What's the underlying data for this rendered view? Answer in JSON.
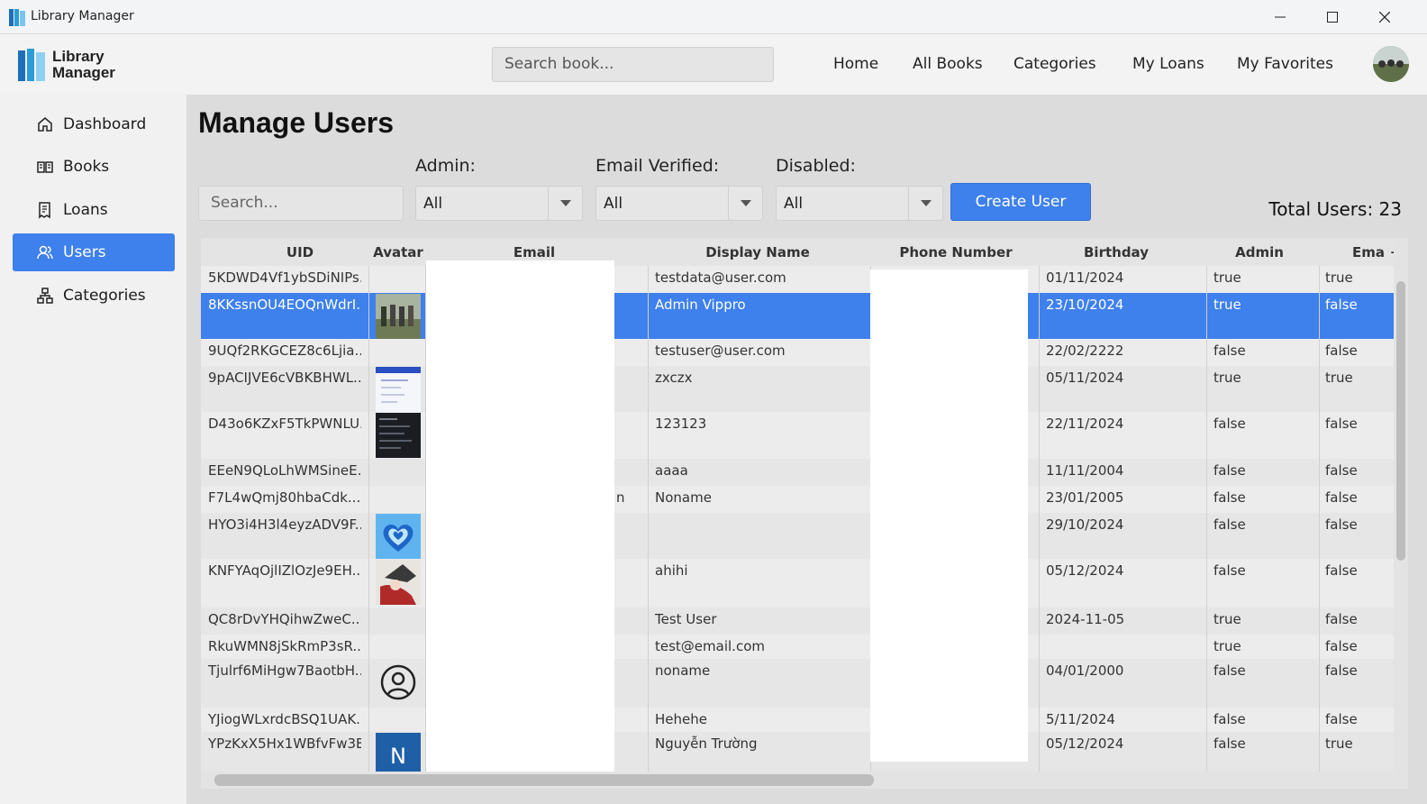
{
  "window": {
    "title": "Library Manager"
  },
  "header": {
    "logo_line1": "Library",
    "logo_line2": "Manager",
    "search_placeholder": "Search book...",
    "nav": [
      "Home",
      "All Books",
      "Categories",
      "My Loans",
      "My Favorites"
    ]
  },
  "sidebar": {
    "items": [
      {
        "label": "Dashboard",
        "icon": "home-icon"
      },
      {
        "label": "Books",
        "icon": "book-icon"
      },
      {
        "label": "Loans",
        "icon": "receipt-icon"
      },
      {
        "label": "Users",
        "icon": "users-icon",
        "active": true
      },
      {
        "label": "Categories",
        "icon": "hierarchy-icon"
      }
    ]
  },
  "main": {
    "title": "Manage Users",
    "search_placeholder": "Search...",
    "filters": [
      {
        "label": "Admin:",
        "value": "All"
      },
      {
        "label": "Email Verified:",
        "value": "All"
      },
      {
        "label": "Disabled:",
        "value": "All"
      }
    ],
    "create_button": "Create User",
    "total": "Total Users: 23"
  },
  "table": {
    "columns": [
      "UID",
      "Avatar",
      "Email",
      "Display Name",
      "Phone Number",
      "Birthday",
      "Admin",
      "Ema"
    ],
    "rows": [
      {
        "uid": "5KDWD4Vf1ybSDiNIPs...",
        "avatar": "",
        "display": "testdata@user.com",
        "birthday": "01/11/2024",
        "admin": "true",
        "email_verified": "true"
      },
      {
        "uid": "8KKssnOU4EOQnWdrI...",
        "avatar": "photo-group",
        "display": "Admin Vippro",
        "birthday": "23/10/2024",
        "admin": "true",
        "email_verified": "false",
        "selected": true
      },
      {
        "uid": "9UQf2RKGCEZ8c6Ljia...",
        "avatar": "",
        "display": "testuser@user.com",
        "birthday": "22/02/2222",
        "admin": "false",
        "email_verified": "false"
      },
      {
        "uid": "9pACIJVE6cVBKBHWL...",
        "avatar": "screenshot-light",
        "display": "zxczx",
        "birthday": "05/11/2024",
        "admin": "true",
        "email_verified": "true"
      },
      {
        "uid": "D43o6KZxF5TkPWNLU...",
        "avatar": "screenshot-dark",
        "display": "123123",
        "birthday": "22/11/2024",
        "admin": "false",
        "email_verified": "false"
      },
      {
        "uid": "EEeN9QLoLhWMSineE...",
        "avatar": "",
        "display": "aaaa",
        "birthday": "11/11/2004",
        "admin": "false",
        "email_verified": "false"
      },
      {
        "uid": "F7L4wQmj80hbaCdk...",
        "avatar": "",
        "display": "Noname",
        "birthday": "23/01/2005",
        "admin": "false",
        "email_verified": "false"
      },
      {
        "uid": "HYO3i4H3l4eyzADV9F...",
        "avatar": "heart",
        "display": "",
        "birthday": "29/10/2024",
        "admin": "false",
        "email_verified": "false"
      },
      {
        "uid": "KNFYAqOjlIZlOzJe9EH...",
        "avatar": "anime-art",
        "display": "ahihi",
        "birthday": "05/12/2024",
        "admin": "false",
        "email_verified": "false"
      },
      {
        "uid": "QC8rDvYHQihwZweC...",
        "avatar": "",
        "display": "Test User",
        "birthday": "2024-11-05",
        "admin": "true",
        "email_verified": "false"
      },
      {
        "uid": "RkuWMN8jSkRmP3sR...",
        "avatar": "",
        "display": "test@email.com",
        "birthday": "",
        "admin": "true",
        "email_verified": "false"
      },
      {
        "uid": "Tjulrf6MiHgw7BaotbH...",
        "avatar": "default-user",
        "display": "noname",
        "birthday": "04/01/2000",
        "admin": "false",
        "email_verified": "false"
      },
      {
        "uid": "YJiogWLxrdcBSQ1UAK...",
        "avatar": "",
        "display": "Hehehe",
        "birthday": "5/11/2024",
        "admin": "false",
        "email_verified": "false"
      },
      {
        "uid": "YPzKxX5Hx1WBfvFw3B...",
        "avatar": "letter-n",
        "avatar_letter": "N",
        "display": "Nguyễn Trường",
        "birthday": "05/12/2024",
        "admin": "false",
        "email_verified": "true"
      }
    ],
    "email_fragment": "n"
  },
  "colors": {
    "accent": "#3e80ec",
    "background": "#dcdcdc"
  }
}
